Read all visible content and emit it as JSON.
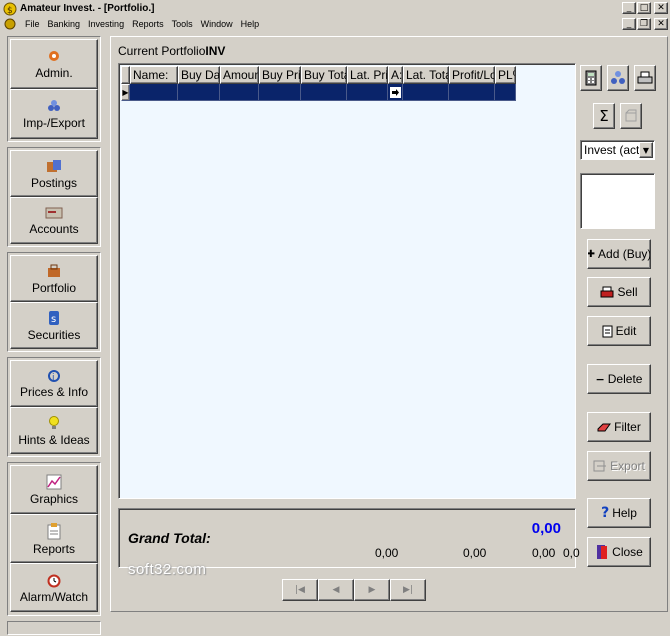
{
  "window": {
    "title": "Amateur Invest. - [Portfolio.]",
    "minimize": "_",
    "maximize": "□",
    "close": "✕",
    "mdi_minimize": "_",
    "mdi_restore": "❐",
    "mdi_close": "✕"
  },
  "menu": [
    "File",
    "Banking",
    "Investing",
    "Reports",
    "Tools",
    "Window",
    "Help"
  ],
  "sidebar": {
    "items": [
      {
        "label": "Admin.",
        "icon": "admin-icon"
      },
      {
        "label": "Imp-/Export",
        "icon": "import-export-icon"
      },
      {
        "label": "Postings",
        "icon": "postings-icon"
      },
      {
        "label": "Accounts",
        "icon": "accounts-icon"
      },
      {
        "label": "Portfolio",
        "icon": "portfolio-icon"
      },
      {
        "label": "Securities",
        "icon": "securities-icon"
      },
      {
        "label": "Prices & Info",
        "icon": "prices-info-icon"
      },
      {
        "label": "Hints & Ideas",
        "icon": "hints-ideas-icon"
      },
      {
        "label": "Graphics",
        "icon": "graphics-icon"
      },
      {
        "label": "Reports",
        "icon": "reports-icon"
      },
      {
        "label": "Alarm/Watch",
        "icon": "alarm-watch-icon"
      }
    ]
  },
  "main": {
    "portfolio_label": "Current Portfolio",
    "portfolio_name": "INV",
    "columns": [
      "Name:",
      "Buy Date",
      "Amount",
      "Buy Price",
      "Buy Total",
      "Lat. Price",
      "A:",
      "Lat. Total",
      "Profit/Loss",
      "PL%"
    ],
    "row_indicator": "▶",
    "grand_total_label": "Grand Total:",
    "grand_total_value": "0,00",
    "subtotals": [
      "0,00",
      "0,00",
      "0,00",
      "0,0"
    ]
  },
  "watermark": "soft32.com",
  "right_panel": {
    "portfolio_select": "Invest (active)",
    "buttons": {
      "add": "Add (Buy)",
      "sell": "Sell",
      "edit": "Edit",
      "delete": "Delete",
      "filter": "Filter",
      "export": "Export",
      "help": "Help",
      "close": "Close"
    }
  },
  "colors": {
    "selection": "#0a246a",
    "grid_background": "#f0f8ff",
    "total_value": "#0000ee"
  }
}
